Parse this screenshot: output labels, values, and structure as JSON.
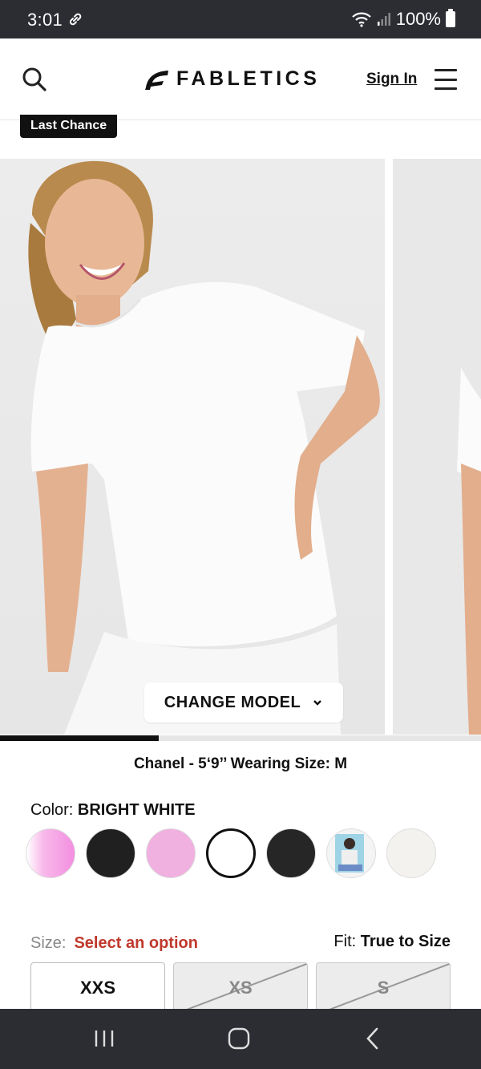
{
  "status_bar": {
    "time": "3:01",
    "battery": "100%"
  },
  "header": {
    "logo_text": "FABLETICS",
    "sign_in": "Sign In"
  },
  "badge": "Last Chance",
  "gallery": {
    "change_model_label": "CHANGE MODEL",
    "progress_fraction": 0.33
  },
  "model_info": "Chanel - 5‘9’’ Wearing Size: M",
  "color": {
    "label": "Color:",
    "selected": "BRIGHT WHITE",
    "swatches": [
      {
        "name": "pink-gradient",
        "color": "#f6a8e6"
      },
      {
        "name": "black",
        "color": "#202020"
      },
      {
        "name": "light-pink",
        "color": "#f0b0e0"
      },
      {
        "name": "bright-white",
        "color": "#ffffff",
        "selected": true
      },
      {
        "name": "black-2",
        "color": "#262626"
      },
      {
        "name": "photo-print",
        "color": "#a8d6e4"
      },
      {
        "name": "off-white",
        "color": "#f3f2ee"
      }
    ]
  },
  "size": {
    "label": "Size:",
    "error": "Select an option",
    "fit_label": "Fit:",
    "fit_value": "True to Size",
    "options": [
      {
        "label": "XXS",
        "available": true
      },
      {
        "label": "XS",
        "available": false
      },
      {
        "label": "S",
        "available": false
      }
    ]
  }
}
